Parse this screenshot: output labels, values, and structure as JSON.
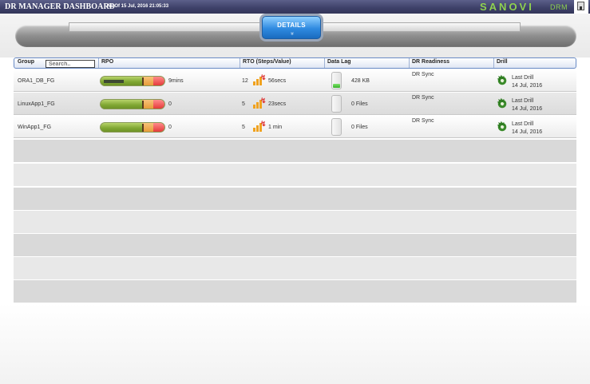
{
  "header": {
    "title": "DR MANAGER DASHBOARD",
    "as_of": "As Of 15 Jul, 2016 21:05:33",
    "brand": "SANOVI",
    "brand_sub": "DRM",
    "device_icon": "device-icon"
  },
  "details_button": {
    "label": "DETAILS",
    "chevron": "»"
  },
  "columns": {
    "group": "Group",
    "rpo": "RPO",
    "rto": "RTO (Steps/Value)",
    "data_lag": "Data Lag",
    "dr_readiness": "DR Readiness",
    "drill": "Drill"
  },
  "search": {
    "placeholder": "Search.."
  },
  "rows": [
    {
      "group": "ORA1_DB_FG",
      "rpo_fill": 0.55,
      "rpo": "9mins",
      "rto_steps": "12",
      "rto_value": "56secs",
      "data_lag": "428 KB",
      "data_lag_level": 0.25,
      "dr_readiness": "DR Sync",
      "drill_label": "Last Drill",
      "drill_date": "14 Jul, 2016"
    },
    {
      "group": "LinuxApp1_FG",
      "rpo_fill": 0,
      "rpo": "0",
      "rto_steps": "5",
      "rto_value": "23secs",
      "data_lag": "0 Files",
      "data_lag_level": 0,
      "dr_readiness": "DR Sync",
      "drill_label": "Last Drill",
      "drill_date": "14 Jul, 2016"
    },
    {
      "group": "WinApp1_FG",
      "rpo_fill": 0,
      "rpo": "0",
      "rto_steps": "5",
      "rto_value": "1 min",
      "data_lag": "0 Files",
      "data_lag_level": 0,
      "dr_readiness": "DR Sync",
      "drill_label": "Last Drill",
      "drill_date": "14 Jul, 2016"
    }
  ],
  "colors": {
    "accent": "#2f8ae0",
    "brand": "#8fd14f",
    "topbar": "#3d4068"
  }
}
